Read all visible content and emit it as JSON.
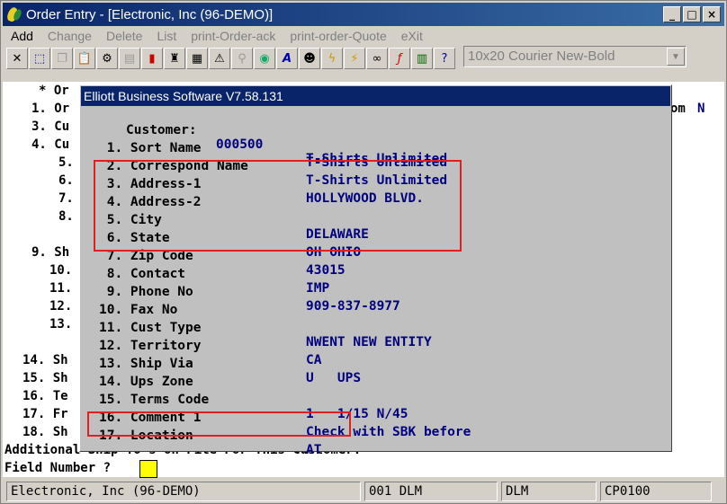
{
  "window": {
    "title": "Order Entry - [Electronic, Inc (96-DEMO)]",
    "minimize": "_",
    "maximize": "□",
    "close": "×"
  },
  "menu": [
    "Add",
    "Change",
    "Delete",
    "List",
    "print-Order-ack",
    "print-order-Quote",
    "eXit"
  ],
  "toolbar": {
    "font_select": "10x20 Courier New-Bold",
    "icons": [
      "close-x-icon",
      "select-icon",
      "copy-icon",
      "paste-icon",
      "settings-icon",
      "properties-icon",
      "stop-icon",
      "stamp-icon",
      "notes-icon",
      "alert-icon",
      "search-icon",
      "globe-icon",
      "italic-a-icon",
      "user-icon",
      "lightning-icon",
      "lightning2-icon",
      "link-icon",
      "function-icon",
      "document-icon",
      "help-pointer-icon"
    ]
  },
  "terminal": {
    "lines": [
      "* Or",
      "1. Or",
      "3. Cu",
      "4. Cu",
      "5.",
      "6.",
      "7.",
      "8.",
      "9. Sh",
      "10.",
      "11.",
      "12.",
      "13.",
      "14. Sh",
      "15. Sh",
      "16. Te",
      "17. Fr",
      "18. Sh"
    ],
    "right_text_a": "om",
    "right_text_b": "N",
    "bottom_line": "Additional Ship To's on File For This Customer.",
    "prompt": "Field Number ?"
  },
  "dialog": {
    "title": "Elliott Business Software V7.58.131",
    "customer_label": "Customer:",
    "customer_no": "000500",
    "customer_name": "T-Shirts Unlimited",
    "fields": [
      {
        "label": " 1. Sort Name",
        "value": "T-Shirts Unlimited"
      },
      {
        "label": " 2. Correspond Name",
        "value": "T-Shirts Unlimited"
      },
      {
        "label": " 3. Address-1",
        "value": "HOLLYWOOD BLVD."
      },
      {
        "label": " 4. Address-2",
        "value": ""
      },
      {
        "label": " 5. City",
        "value": "DELAWARE"
      },
      {
        "label": " 6. State",
        "value": "OH OHIO"
      },
      {
        "label": " 7. Zip Code",
        "value": "43015"
      },
      {
        "label": " 8. Contact",
        "value": "IMP"
      },
      {
        "label": " 9. Phone No",
        "value": "909-837-8977"
      },
      {
        "label": "10. Fax No",
        "value": ""
      },
      {
        "label": "11. Cust Type",
        "value": "NWENT NEW ENTITY"
      },
      {
        "label": "12. Territory",
        "value": "CA"
      },
      {
        "label": "13. Ship Via",
        "value": "U   UPS"
      },
      {
        "label": "14. Ups Zone",
        "value": ""
      },
      {
        "label": "15. Terms Code",
        "value": "1   1/15 N/45"
      },
      {
        "label": "16. Comment 1",
        "value": "Check with SBK before"
      },
      {
        "label": "17. Location",
        "value": "AT"
      }
    ]
  },
  "status": {
    "company": "Electronic, Inc (96-DEMO)",
    "user": "001 DLM",
    "user2": "DLM",
    "program": "CP0100"
  },
  "colors": {
    "highlight": "#e02020",
    "field_value": "#000080",
    "titlebar": "#0a246a"
  }
}
